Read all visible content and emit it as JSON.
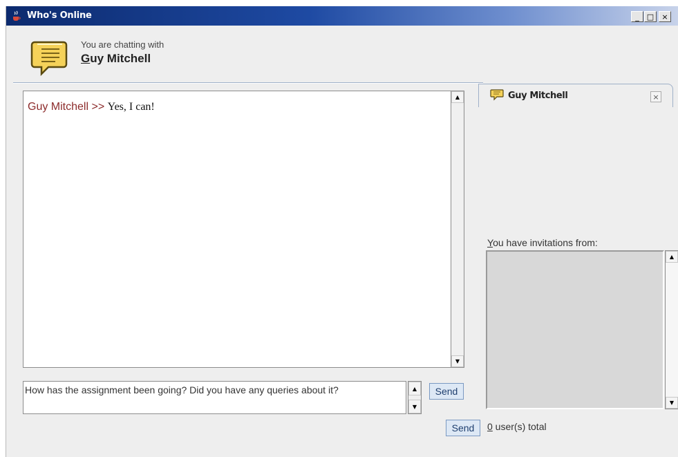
{
  "window": {
    "title": "Who's Online",
    "minimize_label": "_",
    "maximize_label": "□",
    "close_label": "×"
  },
  "header": {
    "chatting_with_label": "You are chatting with",
    "chat_name_first_letter": "G",
    "chat_name_rest": "uy Mitchell"
  },
  "chat": {
    "messages": [
      {
        "sender": "Guy Mitchell",
        "separator": " >> ",
        "text": "Yes, I can!"
      }
    ]
  },
  "input": {
    "value": "How has the assignment been going? Did you have any queries about it?"
  },
  "buttons": {
    "send_top": "Send",
    "send_bottom": "Send"
  },
  "side_panel": {
    "tab_label": "Guy Mitchell",
    "tab_close_label": "×",
    "invitations_label_first": "Y",
    "invitations_label_rest": "ou have invitations from:",
    "user_count_first": "0",
    "user_count_rest": " user(s) total"
  },
  "icons": {
    "app": "java-cup-icon",
    "header": "chat-bubble-icon",
    "tab": "chat-bubble-icon"
  },
  "colors": {
    "titlebar_start": "#0c2a6e",
    "titlebar_end": "#c8d3ea",
    "sender_color": "#8c2b2b",
    "bubble_yellow": "#f5d259",
    "button_bg": "#dde8f5"
  }
}
